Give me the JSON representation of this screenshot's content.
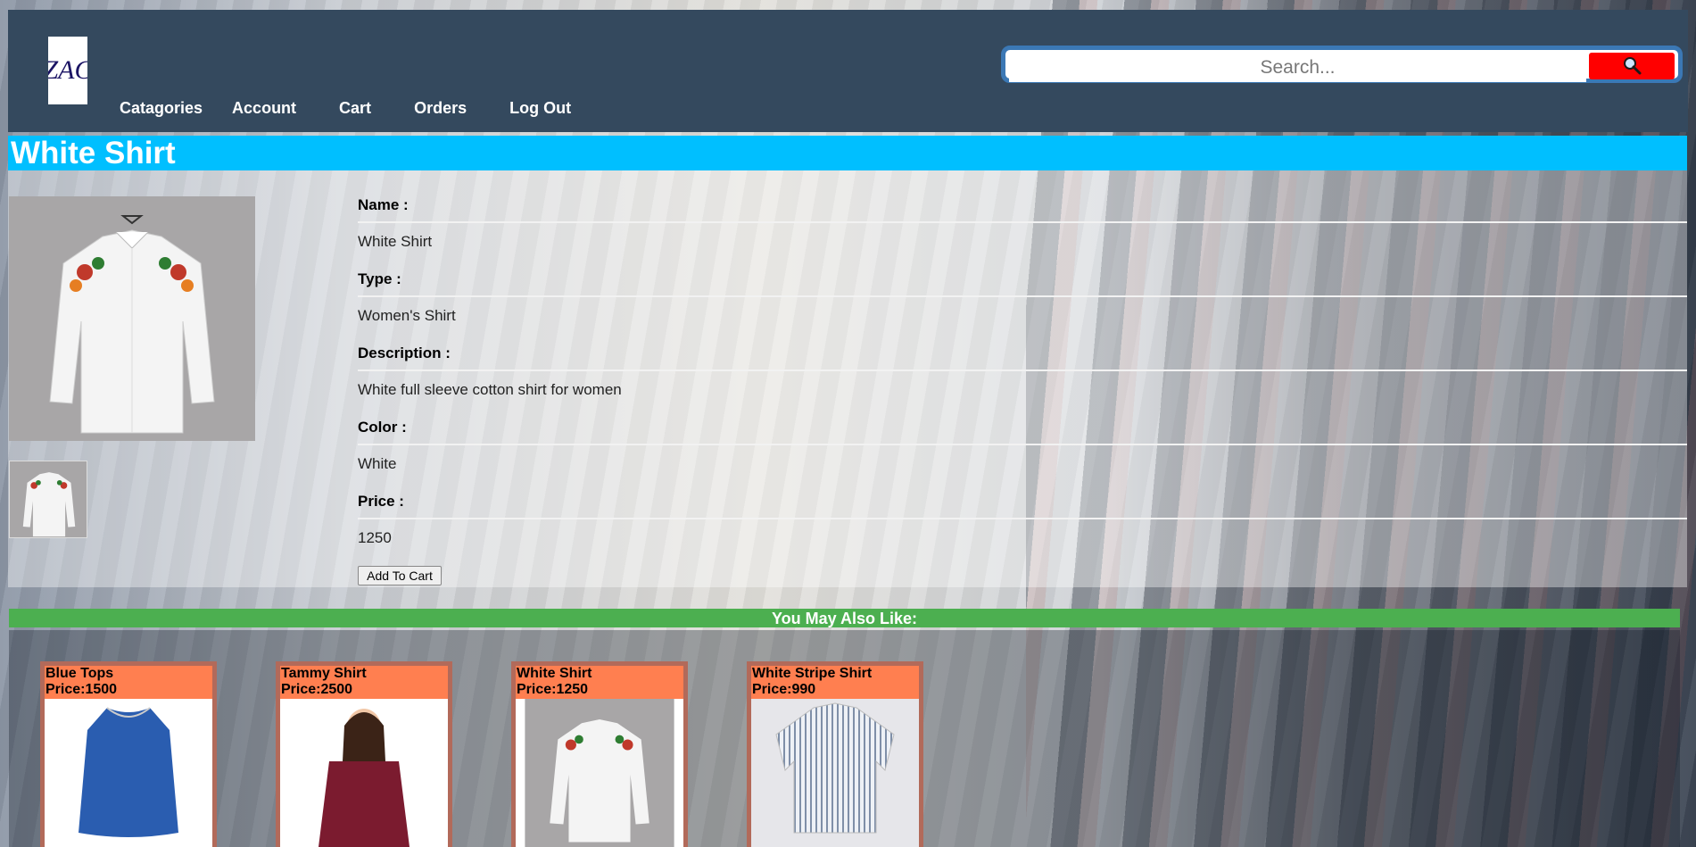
{
  "logo": {
    "text": "ZAC"
  },
  "nav": [
    "Catagories",
    "Account",
    "Cart",
    "Orders",
    "Log Out"
  ],
  "search": {
    "placeholder": "Search..."
  },
  "product": {
    "title": "White Shirt",
    "fields": [
      {
        "label": "Name :",
        "value": "White Shirt"
      },
      {
        "label": "Type :",
        "value": "Women's Shirt"
      },
      {
        "label": "Description :",
        "value": "White full sleeve cotton shirt for women"
      },
      {
        "label": "Color :",
        "value": "White"
      },
      {
        "label": "Price :",
        "value": "1250"
      }
    ],
    "add_to_cart": "Add To Cart"
  },
  "also_like": {
    "heading": "You May Also Like:",
    "items": [
      {
        "name": "Blue Tops",
        "price": "Price:1500"
      },
      {
        "name": "Tammy Shirt",
        "price": "Price:2500"
      },
      {
        "name": "White Shirt",
        "price": "Price:1250"
      },
      {
        "name": "White Stripe Shirt",
        "price": "Price:990"
      }
    ]
  },
  "colors": {
    "header": "#34495e",
    "title_bar": "#00bfff",
    "also_bar": "#4caf50",
    "card_header": "#ff7f50",
    "search_button": "#ff0000"
  }
}
